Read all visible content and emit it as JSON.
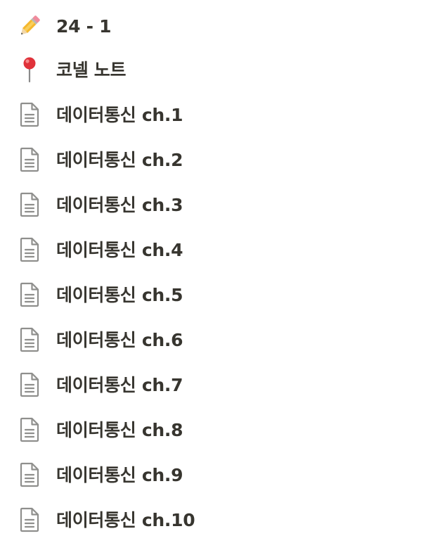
{
  "items": [
    {
      "icon": "pencil-icon",
      "label": "24 - 1"
    },
    {
      "icon": "round-pushpin-icon",
      "label": "코넬 노트"
    },
    {
      "icon": "document-icon",
      "label": "데이터통신 ch.1"
    },
    {
      "icon": "document-icon",
      "label": "데이터통신 ch.2"
    },
    {
      "icon": "document-icon",
      "label": "데이터통신 ch.3"
    },
    {
      "icon": "document-icon",
      "label": "데이터통신 ch.4"
    },
    {
      "icon": "document-icon",
      "label": "데이터통신 ch.5"
    },
    {
      "icon": "document-icon",
      "label": "데이터통신 ch.6"
    },
    {
      "icon": "document-icon",
      "label": "데이터통신 ch.7"
    },
    {
      "icon": "document-icon",
      "label": "데이터통신 ch.8"
    },
    {
      "icon": "document-icon",
      "label": "데이터통신 ch.9"
    },
    {
      "icon": "document-icon",
      "label": "데이터통신 ch.10"
    }
  ],
  "colors": {
    "text": "#37352f",
    "doc_icon": "#8f8f8d",
    "pin_head": "#e0323a",
    "pencil_body": "#f5b82e"
  }
}
